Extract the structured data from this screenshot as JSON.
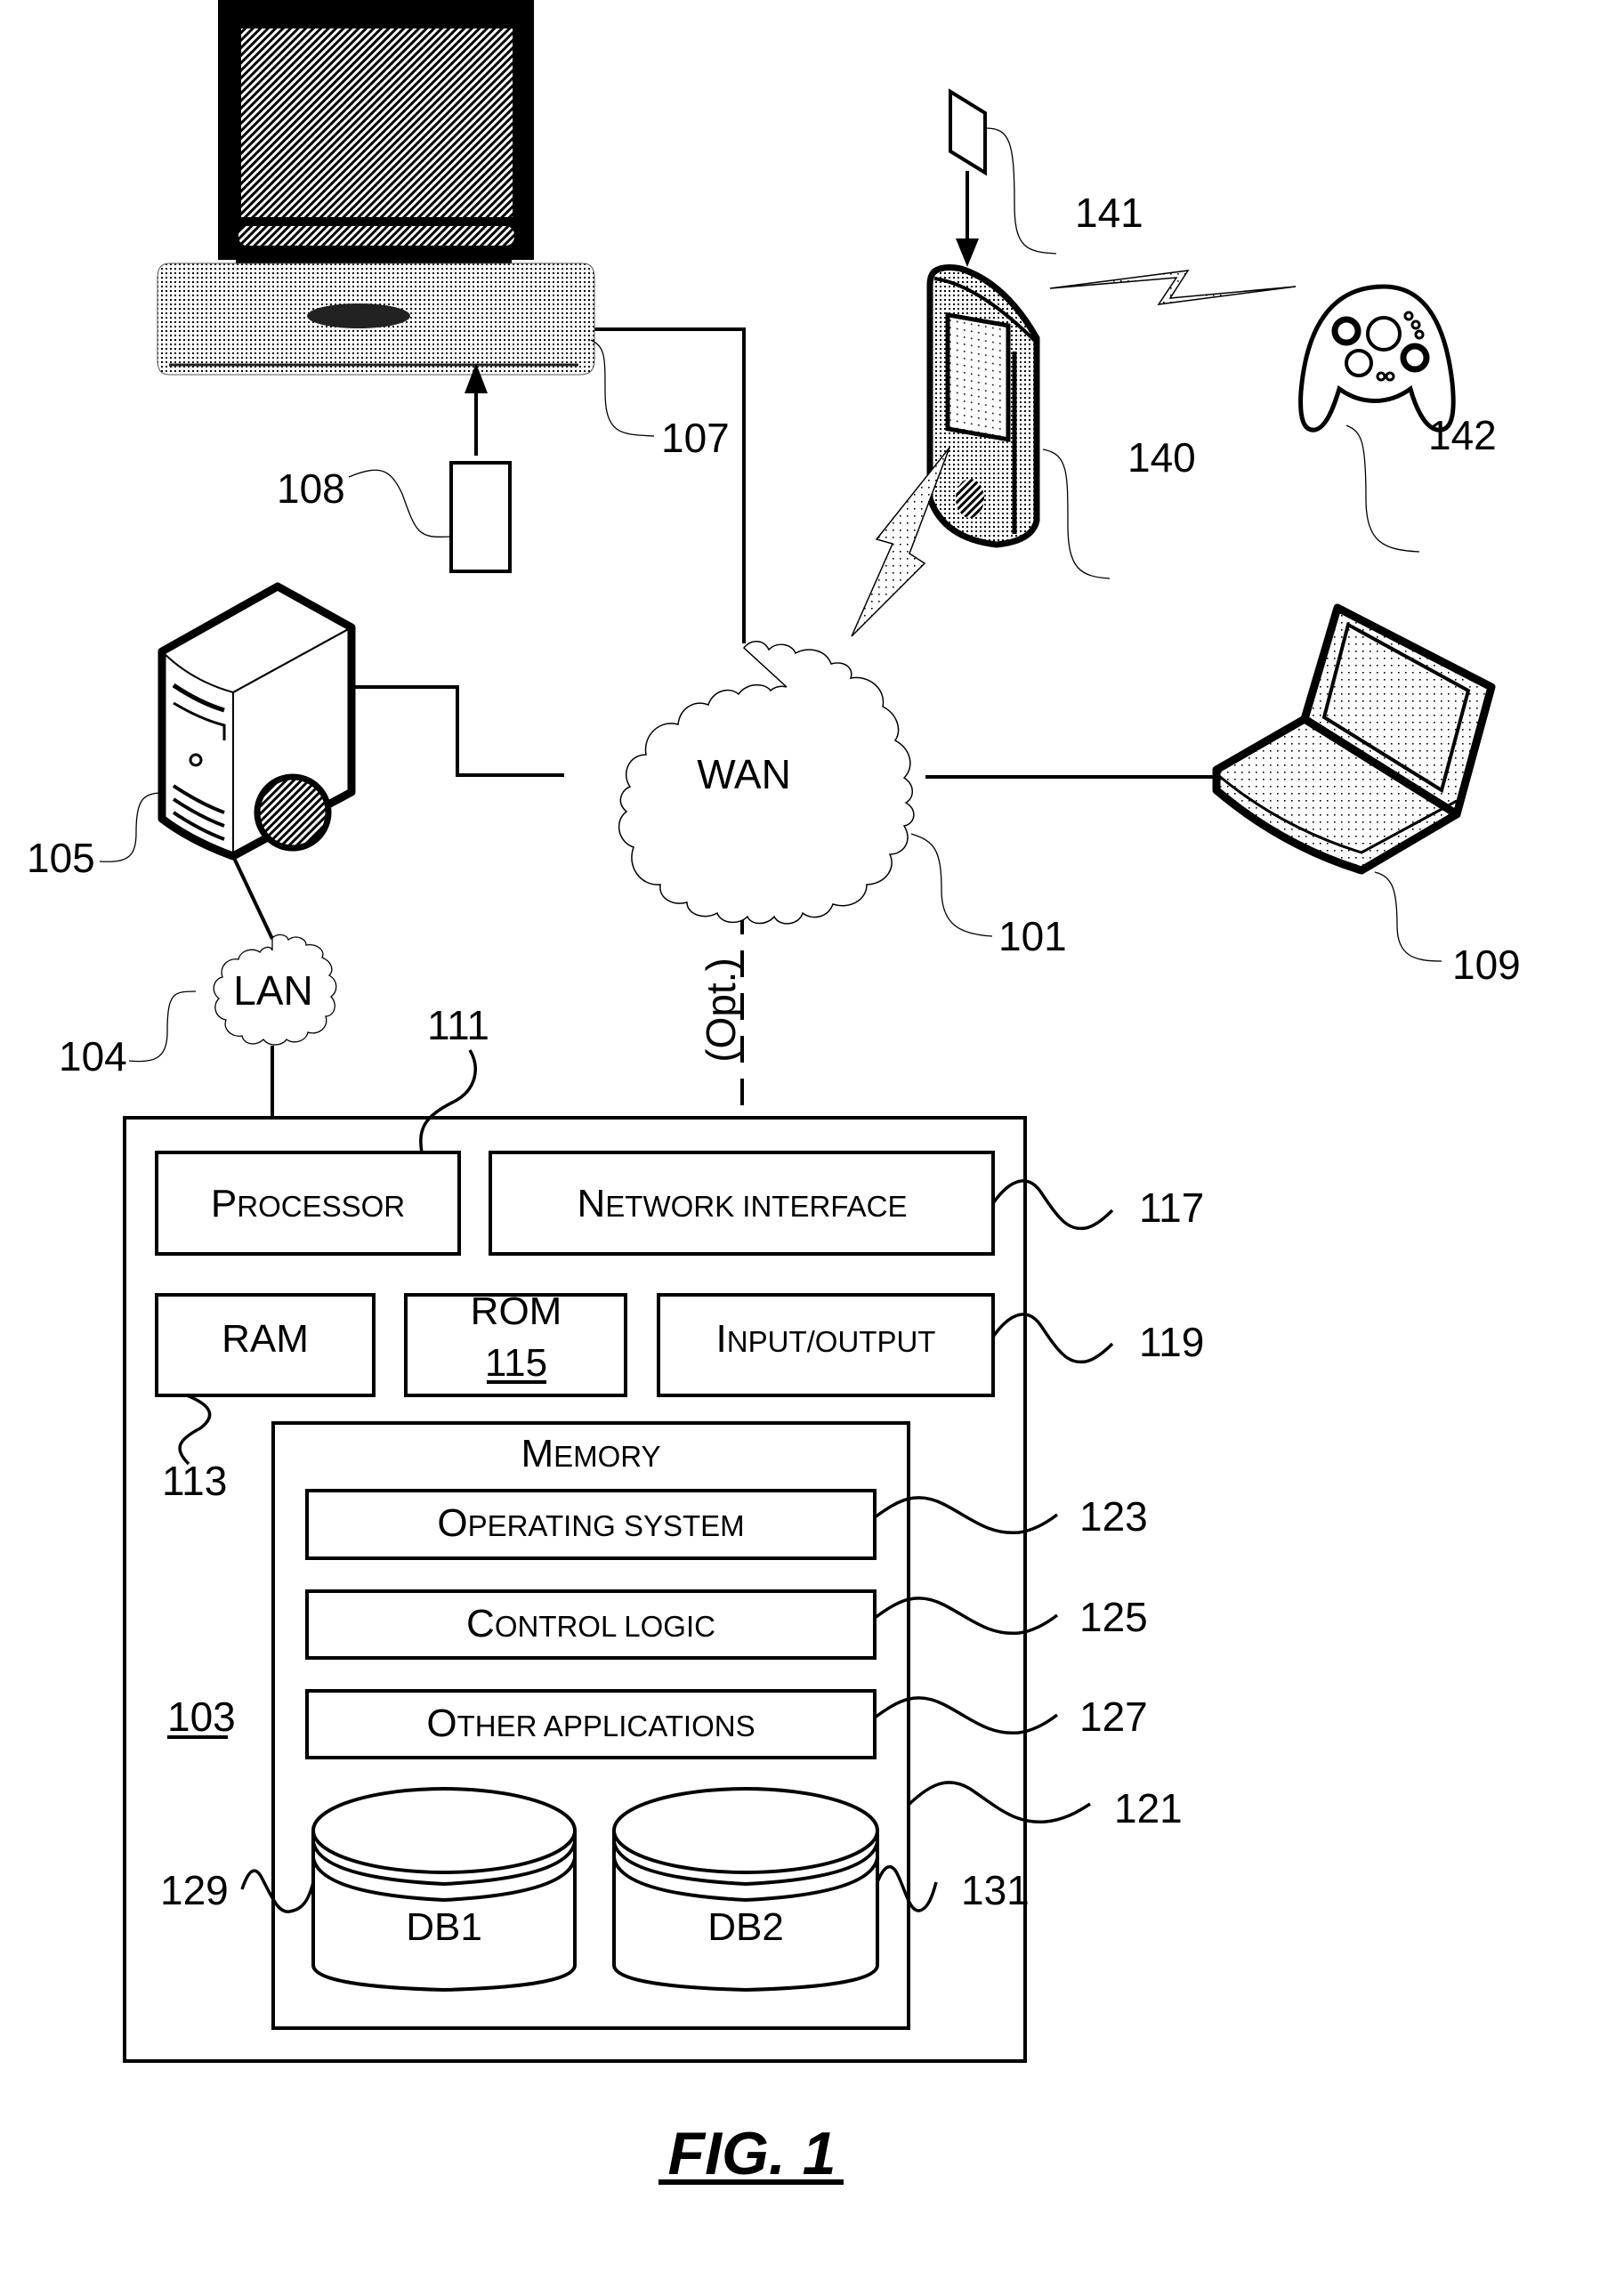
{
  "figure": {
    "title": "FIG. 1",
    "colors": {
      "ink": "#000000",
      "paper": "#ffffff",
      "halftone": "#8a8a8a"
    }
  },
  "network": {
    "wan_label": "WAN",
    "wan_ref": "101",
    "lan_label": "LAN",
    "lan_ref": "104",
    "optional_link_label": "(Opt.)"
  },
  "devices": {
    "server_ref": "105",
    "set_top_box_ref": "107",
    "remote_ref": "108",
    "laptop_ref": "109",
    "mobile_device_ref": "140",
    "card_ref": "141",
    "game_controller_ref": "142"
  },
  "computer": {
    "ref": "103",
    "processor": {
      "label_first": "P",
      "label_rest": "ROCESSOR",
      "ref": "111"
    },
    "network_interface": {
      "label_first": "N",
      "label_rest": "ETWORK INTERFACE",
      "ref": "117"
    },
    "ram": {
      "label": "RAM",
      "ref": "113"
    },
    "rom": {
      "label": "ROM",
      "ref": "115"
    },
    "io": {
      "label_first": "I",
      "label_rest": "NPUT/OUTPUT",
      "ref": "119"
    },
    "memory": {
      "label_first": "M",
      "label_rest": "EMORY",
      "ref": "121",
      "items": [
        {
          "label_first": "O",
          "label_rest": "PERATING SYSTEM",
          "ref": "123"
        },
        {
          "label_first": "C",
          "label_rest": "ONTROL LOGIC",
          "ref": "125"
        },
        {
          "label_first": "O",
          "label_rest": "THER APPLICATIONS",
          "ref": "127"
        }
      ],
      "databases": [
        {
          "label": "DB1",
          "ref": "129"
        },
        {
          "label": "DB2",
          "ref": "131"
        }
      ]
    }
  }
}
